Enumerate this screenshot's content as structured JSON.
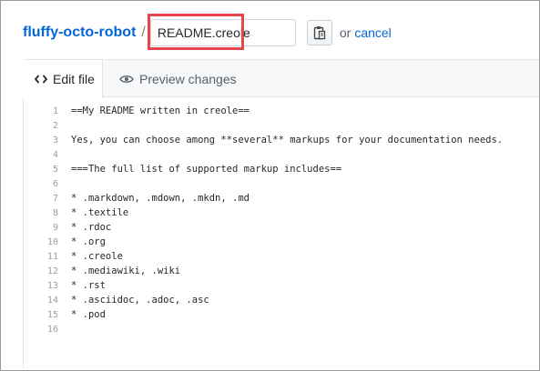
{
  "header": {
    "repo_name": "fluffy-octo-robot",
    "separator": "/",
    "filename_value": "README.creole",
    "or_text": "or",
    "cancel_label": "cancel"
  },
  "tabs": [
    {
      "label": "Edit file",
      "icon": "code-icon",
      "active": true
    },
    {
      "label": "Preview changes",
      "icon": "eye-icon",
      "active": false
    }
  ],
  "colors": {
    "link": "#0366d6",
    "highlight": "#e8454d",
    "line_number": "#959da5"
  },
  "code_lines": [
    {
      "n": "1",
      "text": "==My README written in creole=="
    },
    {
      "n": "2",
      "text": ""
    },
    {
      "n": "3",
      "text": "Yes, you can choose among **several** markups for your documentation needs."
    },
    {
      "n": "4",
      "text": ""
    },
    {
      "n": "5",
      "text": "===The full list of supported markup includes=="
    },
    {
      "n": "6",
      "text": ""
    },
    {
      "n": "7",
      "text": "* .markdown, .mdown, .mkdn, .md"
    },
    {
      "n": "8",
      "text": "* .textile"
    },
    {
      "n": "9",
      "text": "* .rdoc"
    },
    {
      "n": "10",
      "text": "* .org"
    },
    {
      "n": "11",
      "text": "* .creole"
    },
    {
      "n": "12",
      "text": "* .mediawiki, .wiki"
    },
    {
      "n": "13",
      "text": "* .rst"
    },
    {
      "n": "14",
      "text": "* .asciidoc, .adoc, .asc"
    },
    {
      "n": "15",
      "text": "* .pod"
    },
    {
      "n": "16",
      "text": ""
    }
  ]
}
